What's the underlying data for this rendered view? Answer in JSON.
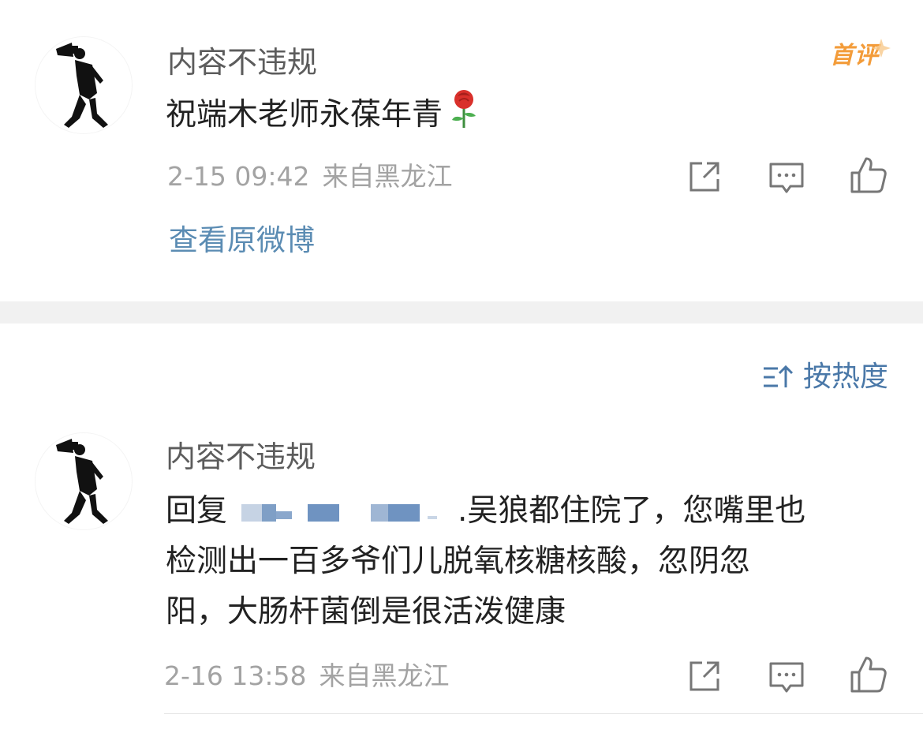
{
  "comment1": {
    "username": "内容不违规",
    "text": "祝端木老师永葆年青",
    "emoji": "rose-emoji",
    "badge": "首评",
    "date": "2-15 09:42",
    "location": "来自黑龙江",
    "view_original": "查看原微博"
  },
  "sort": {
    "label": "按热度",
    "icon": "sort-icon"
  },
  "comment2": {
    "username": "内容不违规",
    "reply_prefix": "回复",
    "reply_rest": ".吴狼都住院了，您嘴里也",
    "line2": "检测出一百多爷们儿脱氧核糖核酸，忽阴忽",
    "line3": "阳，大肠杆菌倒是很活泼健康",
    "date": "2-16 13:58",
    "location": "来自黑龙江"
  },
  "colors": {
    "link": "#5b8cb3",
    "badge": "#f39c3a",
    "meta": "#a3a3a3",
    "separator": "#f1f1f1"
  }
}
